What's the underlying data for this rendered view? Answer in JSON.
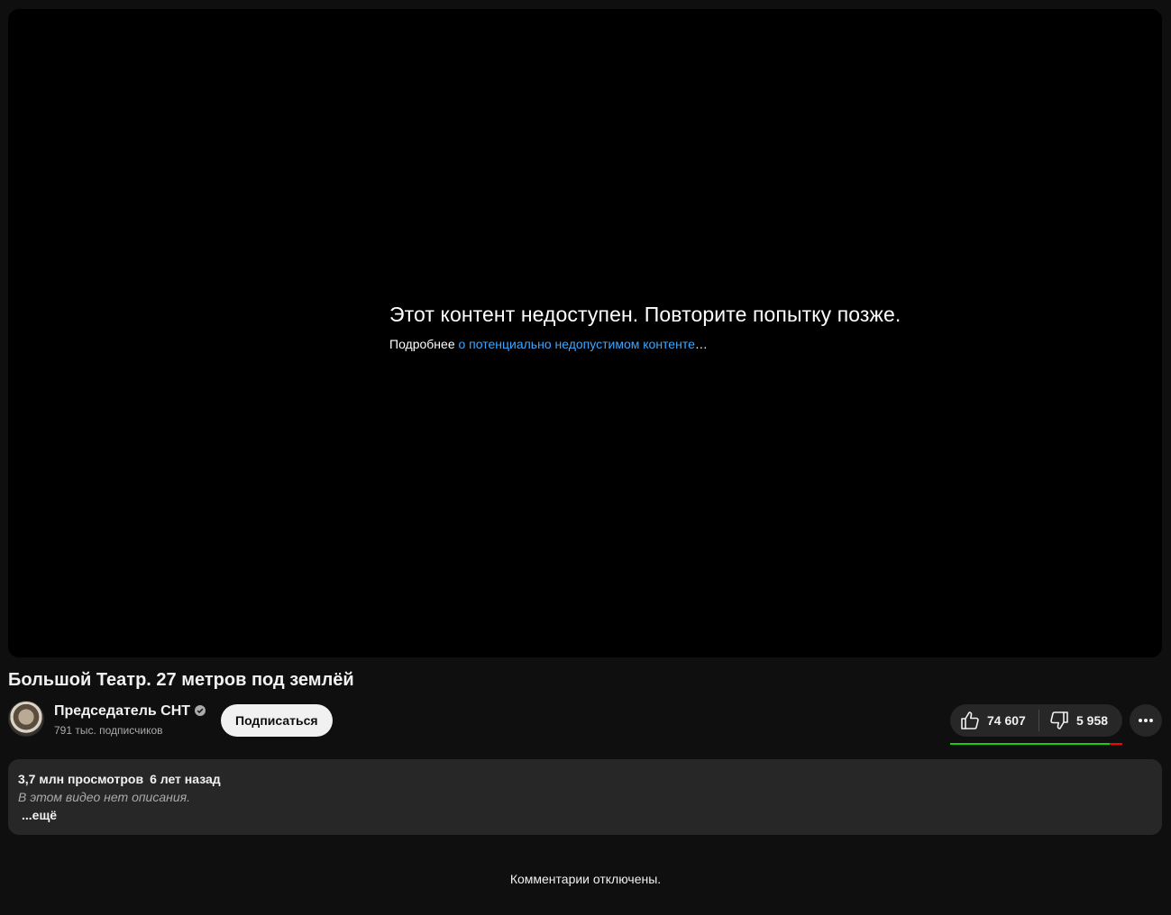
{
  "player": {
    "error_title": "Этот контент недоступен. Повторите попытку позже.",
    "error_prefix": "Подробнее ",
    "error_link": "о потенциально недопустимом контенте",
    "error_suffix": "…"
  },
  "video": {
    "title": "Большой Театр. 27 метров под землёй"
  },
  "channel": {
    "name": "Председатель СНТ",
    "subscribers": "791 тыс. подписчиков",
    "subscribe_label": "Подписаться",
    "verified_icon": "verified-check-icon"
  },
  "actions": {
    "likes": "74 607",
    "dislikes": "5 958",
    "like_ratio": 0.926,
    "like_icon": "thumbs-up-icon",
    "dislike_icon": "thumbs-down-icon",
    "more_icon": "more-horizontal-icon",
    "colors": {
      "like_bar": "#12d200",
      "dislike_bar": "#ff0000"
    }
  },
  "description": {
    "views": "3,7 млн просмотров",
    "date": "6 лет назад",
    "empty_text": "В этом видео нет описания.",
    "more_label": "...ещё"
  },
  "comments": {
    "status": "Комментарии отключены."
  }
}
